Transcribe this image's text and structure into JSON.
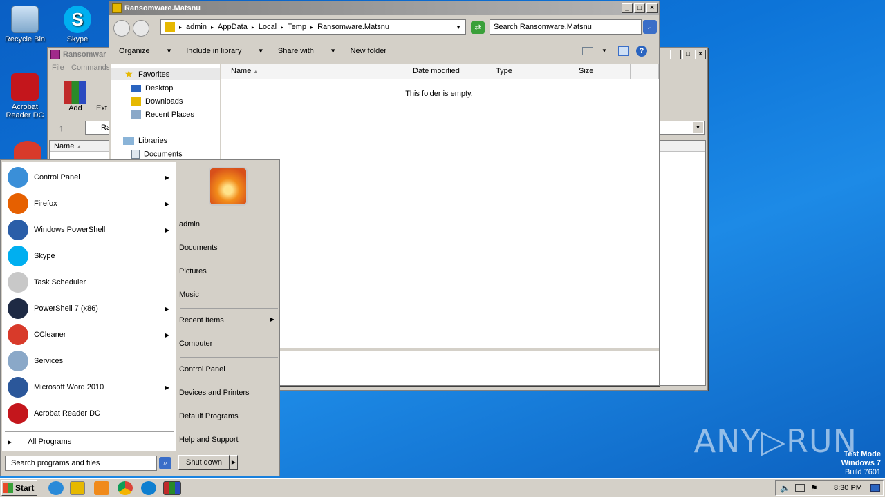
{
  "desktop": {
    "icons": [
      {
        "label": "Recycle Bin",
        "icon": "recycle-bin-icon"
      },
      {
        "label": "Skype",
        "icon": "skype-icon"
      },
      {
        "label": "Acrobat Reader DC",
        "icon": "acrobat-icon"
      }
    ],
    "watermark": "ANY▷RUN",
    "test_mode": [
      "Test Mode",
      "Windows 7",
      "Build 7601"
    ]
  },
  "winrar": {
    "title": "Ransomwar",
    "menu": [
      "File",
      "Commands"
    ],
    "toolbar": [
      "Add",
      "Ext"
    ],
    "path": "Ra",
    "col_name": "Name"
  },
  "explorer": {
    "title": "Ransomware.Matsnu",
    "breadcrumb": [
      "admin",
      "AppData",
      "Local",
      "Temp",
      "Ransomware.Matsnu"
    ],
    "search_placeholder": "Search Ransomware.Matsnu",
    "commands": {
      "organize": "Organize",
      "include": "Include in library",
      "share": "Share with",
      "new_folder": "New folder"
    },
    "nav": {
      "favorites": "Favorites",
      "desktop": "Desktop",
      "downloads": "Downloads",
      "recent": "Recent Places",
      "libraries": "Libraries",
      "documents": "Documents"
    },
    "columns": {
      "name": "Name",
      "date": "Date modified",
      "type": "Type",
      "size": "Size"
    },
    "empty_message": "This folder is empty."
  },
  "start_menu": {
    "programs": [
      {
        "label": "Control Panel",
        "icon": "control-panel-icon",
        "color": "#3a8fd8",
        "arrow": true
      },
      {
        "label": "Firefox",
        "icon": "firefox-icon",
        "color": "#e66000",
        "arrow": true
      },
      {
        "label": "Windows PowerShell",
        "icon": "powershell-icon",
        "color": "#2a5ea8",
        "arrow": true
      },
      {
        "label": "Skype",
        "icon": "skype-icon",
        "color": "#00aff0",
        "arrow": false
      },
      {
        "label": "Task Scheduler",
        "icon": "clock-icon",
        "color": "#c8c8c8",
        "arrow": false
      },
      {
        "label": "PowerShell 7 (x86)",
        "icon": "powershell-7-icon",
        "color": "#1e2a44",
        "arrow": true
      },
      {
        "label": "CCleaner",
        "icon": "ccleaner-icon",
        "color": "#d83a2a",
        "arrow": true
      },
      {
        "label": "Services",
        "icon": "services-gear-icon",
        "color": "#8aa8c8",
        "arrow": false
      },
      {
        "label": "Microsoft Word 2010",
        "icon": "word-icon",
        "color": "#2b579a",
        "arrow": true
      },
      {
        "label": "Acrobat Reader DC",
        "icon": "acrobat-icon",
        "color": "#c4161c",
        "arrow": false
      }
    ],
    "all_programs": "All Programs",
    "search_placeholder": "Search programs and files",
    "right": {
      "user": "admin",
      "documents": "Documents",
      "pictures": "Pictures",
      "music": "Music",
      "recent_items": "Recent Items",
      "computer": "Computer",
      "control_panel": "Control Panel",
      "devices": "Devices and Printers",
      "default_programs": "Default Programs",
      "help": "Help and Support"
    },
    "shutdown": "Shut down"
  },
  "taskbar": {
    "start": "Start",
    "clock": "8:30 PM"
  }
}
